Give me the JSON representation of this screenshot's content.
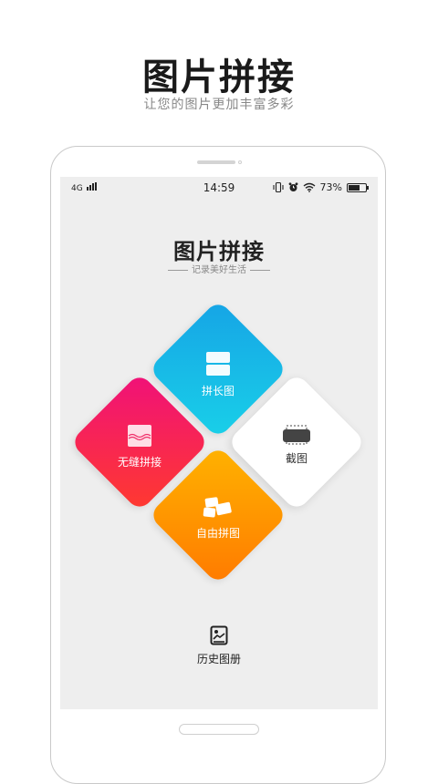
{
  "promo": {
    "title": "图片拼接",
    "subtitle": "让您的图片更加丰富多彩"
  },
  "status_bar": {
    "network": "4G",
    "time": "14:59",
    "battery_percent": "73%",
    "battery_level": 0.73,
    "icons": [
      "signal-icon",
      "vibrate-icon",
      "alarm-icon",
      "wifi-icon",
      "battery-icon"
    ]
  },
  "app": {
    "title": "图片拼接",
    "slogan": "记录美好生活"
  },
  "menu": {
    "long": {
      "label": "拼长图",
      "icon": "long-stitch-icon"
    },
    "seamless": {
      "label": "无缝拼接",
      "icon": "seamless-stitch-icon"
    },
    "crop": {
      "label": "截图",
      "icon": "screenshot-icon"
    },
    "free": {
      "label": "自由拼图",
      "icon": "free-collage-icon"
    }
  },
  "history": {
    "label": "历史图册",
    "icon": "history-album-icon"
  },
  "colors": {
    "long_tile": "#16a4e6",
    "seamless_tile": "#f0107a",
    "free_tile": "#ff9800",
    "crop_tile": "#ffffff",
    "screen_bg": "#eeeeee"
  }
}
